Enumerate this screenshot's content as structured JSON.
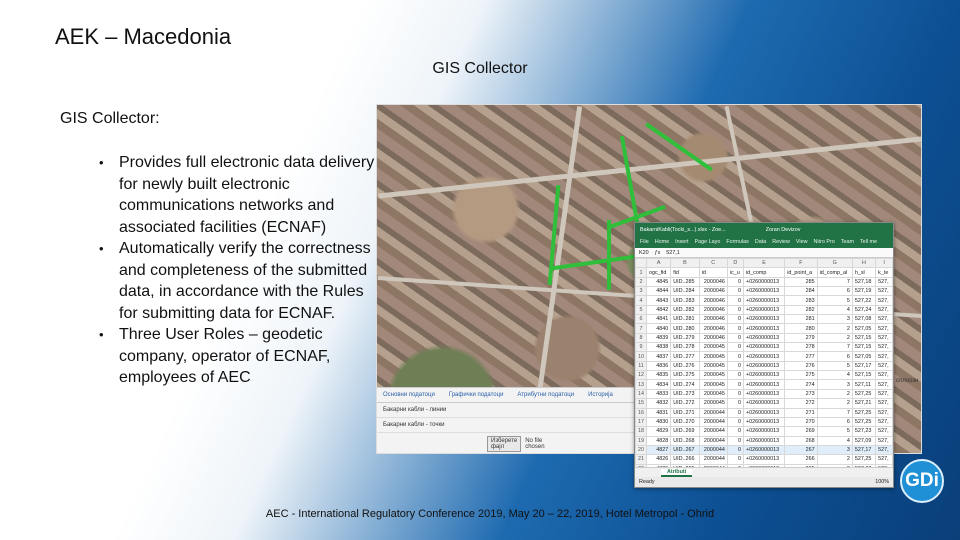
{
  "title": "AEK – Macedonia",
  "subtitle": "GIS Collector",
  "section_heading": "GIS Collector:",
  "bullets": [
    "Provides full electronic data delivery for newly built electronic communications networks and associated facilities (ECNAF)",
    "Automatically verify the correctness and completeness of the submitted data, in accordance with the Rules for submitting data for ECNAF.",
    "Three User Roles – geodetic company, operator of ECNAF, employees of AEC"
  ],
  "bullet_symbol": "•",
  "footer": "AEC - International Regulatory Conference 2019, May 20 – 22, 2019, Hotel Metropol - Ohrid",
  "logo_text": "GDi",
  "map_panel": {
    "tabs": [
      "Основни податоци",
      "Графички податоци",
      "Атрибутни податоци",
      "Историја"
    ],
    "row1": "Бакарни кабли - линии",
    "row2": "Бакарни кабли - точки",
    "file_button": "Изберете фајл",
    "file_status": "No file chosen"
  },
  "map_edge_text": "сплоозн",
  "sheet": {
    "titlebar_left": "BakarniKabli(Tocki_s...).xlsx - Zoe...",
    "titlebar_right": "Zoran Devizov",
    "ribbon": [
      "File",
      "Home",
      "Insert",
      "Page Layo",
      "Formulas",
      "Data",
      "Review",
      "View",
      "Nitro Pro",
      "Team",
      "Tell me"
    ],
    "cell_ref": "K20",
    "formula_value": "527,1",
    "col_headers": [
      "",
      "A",
      "B",
      "C",
      "D",
      "E",
      "F",
      "G",
      "H",
      "I"
    ],
    "field_names": [
      "ogc_fid",
      "fid",
      "id",
      "ic_u",
      "id_comp",
      "id_point_a",
      "id_comp_al",
      "h_sl",
      "k_te"
    ],
    "rows": [
      [
        "2",
        "4845",
        "UID..285",
        "2000046",
        "0",
        "+0260000013",
        "285",
        "7",
        "527,18",
        "527,"
      ],
      [
        "3",
        "4844",
        "UID..284",
        "2000046",
        "0",
        "+0260000013",
        "284",
        "6",
        "527,19",
        "527,"
      ],
      [
        "4",
        "4843",
        "UID..283",
        "2000046",
        "0",
        "+0260000013",
        "283",
        "5",
        "527,22",
        "527,"
      ],
      [
        "5",
        "4842",
        "UID..282",
        "2000046",
        "0",
        "+0260000013",
        "282",
        "4",
        "527,24",
        "527,"
      ],
      [
        "6",
        "4841",
        "UID..281",
        "2000046",
        "0",
        "+0260000013",
        "281",
        "3",
        "527,08",
        "527,"
      ],
      [
        "7",
        "4840",
        "UID..280",
        "2000046",
        "0",
        "+0260000013",
        "280",
        "2",
        "527,05",
        "527,"
      ],
      [
        "8",
        "4839",
        "UID..279",
        "2000046",
        "0",
        "+0260000013",
        "279",
        "2",
        "527,15",
        "527,"
      ],
      [
        "9",
        "4838",
        "UID..278",
        "2000045",
        "0",
        "+0260000013",
        "278",
        "7",
        "527,15",
        "527,"
      ],
      [
        "10",
        "4837",
        "UID..277",
        "2000045",
        "0",
        "+0260000013",
        "277",
        "6",
        "527,05",
        "527,"
      ],
      [
        "11",
        "4836",
        "UID..276",
        "2000045",
        "0",
        "+0260000013",
        "276",
        "5",
        "527,17",
        "527,"
      ],
      [
        "12",
        "4835",
        "UID..275",
        "2000045",
        "0",
        "+0260000013",
        "275",
        "4",
        "527,15",
        "527,"
      ],
      [
        "13",
        "4834",
        "UID..274",
        "2000045",
        "0",
        "+0260000013",
        "274",
        "3",
        "527,11",
        "527,"
      ],
      [
        "14",
        "4833",
        "UID..273",
        "2000045",
        "0",
        "+0260000013",
        "273",
        "2",
        "527,25",
        "527,"
      ],
      [
        "15",
        "4832",
        "UID..272",
        "2000045",
        "0",
        "+0260000013",
        "272",
        "2",
        "527,21",
        "527,"
      ],
      [
        "16",
        "4831",
        "UID..271",
        "2000044",
        "0",
        "+0260000013",
        "271",
        "7",
        "527,25",
        "527,"
      ],
      [
        "17",
        "4830",
        "UID..270",
        "2000044",
        "0",
        "+0260000013",
        "270",
        "6",
        "527,25",
        "527,"
      ],
      [
        "18",
        "4829",
        "UID..269",
        "2000044",
        "0",
        "+0260000013",
        "269",
        "5",
        "527,23",
        "527,"
      ],
      [
        "19",
        "4828",
        "UID..268",
        "2000044",
        "0",
        "+0260000013",
        "268",
        "4",
        "527,09",
        "527,"
      ],
      [
        "20",
        "4827",
        "UID..267",
        "2000044",
        "0",
        "+0260000013",
        "267",
        "3",
        "527,17",
        "527,"
      ],
      [
        "21",
        "4826",
        "UID..266",
        "2000044",
        "0",
        "+0260000013",
        "266",
        "2",
        "527,25",
        "527,"
      ],
      [
        "22",
        "4825",
        "UID..265",
        "2000044",
        "0",
        "+0260000013",
        "265",
        "2",
        "527,37",
        "528,"
      ]
    ],
    "selected_row": "20",
    "sheet_tab": "Atributi",
    "status_left": "Ready",
    "status_right": "100%"
  }
}
